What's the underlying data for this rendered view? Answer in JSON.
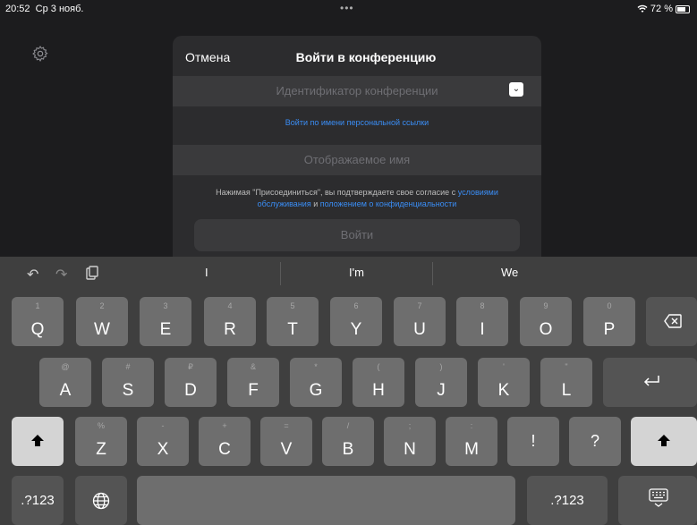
{
  "status": {
    "time": "20:52",
    "date": "Ср 3 нояб.",
    "dots": "•••",
    "battery": "72 %"
  },
  "dialog": {
    "cancel": "Отмена",
    "title": "Войти в конференцию",
    "meeting_id_placeholder": "Идентификатор конференции",
    "personal_link": "Войти по имени персональной ссылки",
    "display_name_placeholder": "Отображаемое имя",
    "terms_prefix": "Нажимая \"Присоединиться\", вы подтверждаете свое согласие с ",
    "terms_link": "условиями обслуживания",
    "terms_and": " и ",
    "privacy_link": "положением о конфиденциальности",
    "join": "Войти"
  },
  "keyboard": {
    "suggestions": [
      "I",
      "I'm",
      "We"
    ],
    "row1": [
      {
        "k": "Q",
        "s": "1"
      },
      {
        "k": "W",
        "s": "2"
      },
      {
        "k": "E",
        "s": "3"
      },
      {
        "k": "R",
        "s": "4"
      },
      {
        "k": "T",
        "s": "5"
      },
      {
        "k": "Y",
        "s": "6"
      },
      {
        "k": "U",
        "s": "7"
      },
      {
        "k": "I",
        "s": "8"
      },
      {
        "k": "O",
        "s": "9"
      },
      {
        "k": "P",
        "s": "0"
      }
    ],
    "row2": [
      {
        "k": "A",
        "s": "@"
      },
      {
        "k": "S",
        "s": "#"
      },
      {
        "k": "D",
        "s": "₽"
      },
      {
        "k": "F",
        "s": "&"
      },
      {
        "k": "G",
        "s": "*"
      },
      {
        "k": "H",
        "s": "("
      },
      {
        "k": "J",
        "s": ")"
      },
      {
        "k": "K",
        "s": "'"
      },
      {
        "k": "L",
        "s": "\""
      }
    ],
    "row3": [
      {
        "k": "Z",
        "s": "%"
      },
      {
        "k": "X",
        "s": "-"
      },
      {
        "k": "C",
        "s": "+"
      },
      {
        "k": "V",
        "s": "="
      },
      {
        "k": "B",
        "s": "/"
      },
      {
        "k": "N",
        "s": ";"
      },
      {
        "k": "M",
        "s": ":"
      },
      {
        "k": "!",
        "s": ""
      },
      {
        "k": "?",
        "s": ""
      }
    ],
    "numbers_left": ".?123",
    "numbers_right": ".?123"
  }
}
